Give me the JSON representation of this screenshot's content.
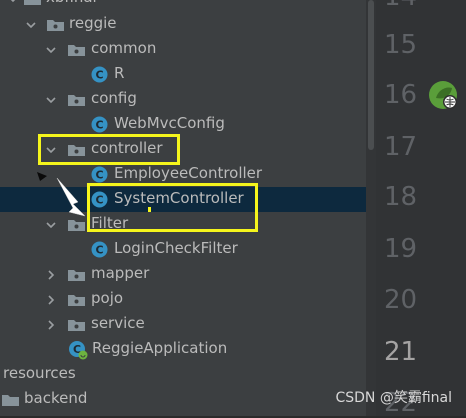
{
  "tree": {
    "top_partial": "xbfinal",
    "items": [
      {
        "label": "reggie",
        "type": "folder",
        "expanded": true
      },
      {
        "label": "common",
        "type": "folder",
        "expanded": true
      },
      {
        "label": "R",
        "type": "class"
      },
      {
        "label": "config",
        "type": "folder",
        "expanded": true
      },
      {
        "label": "WebMvcConfig",
        "type": "class"
      },
      {
        "label": "controller",
        "type": "folder",
        "expanded": true
      },
      {
        "label": "EmployeeController",
        "type": "class"
      },
      {
        "label": "SystemController",
        "type": "class",
        "selected": true
      },
      {
        "label": "Filter",
        "type": "folder",
        "expanded": true
      },
      {
        "label": "LoginCheckFilter",
        "type": "class"
      },
      {
        "label": "mapper",
        "type": "folder",
        "expanded": false
      },
      {
        "label": "pojo",
        "type": "folder",
        "expanded": false
      },
      {
        "label": "service",
        "type": "folder",
        "expanded": false
      },
      {
        "label": "ReggieApplication",
        "type": "spring-class"
      },
      {
        "label": "resources",
        "type": "text"
      },
      {
        "label": "backend",
        "type": "folder",
        "expanded": false
      }
    ]
  },
  "gutter": {
    "lines": [
      "14",
      "15",
      "16",
      "17",
      "18",
      "19",
      "20",
      "21",
      "22"
    ],
    "current_line": "21"
  },
  "watermark": "CSDN @笑霸final",
  "colors": {
    "tree_bg": "#3c3f41",
    "editor_bg": "#2b2b2b",
    "selection": "#0d293e",
    "highlight_box": "#f5f51c",
    "class_icon": "#3592c4",
    "folder_icon": "#87939a"
  }
}
